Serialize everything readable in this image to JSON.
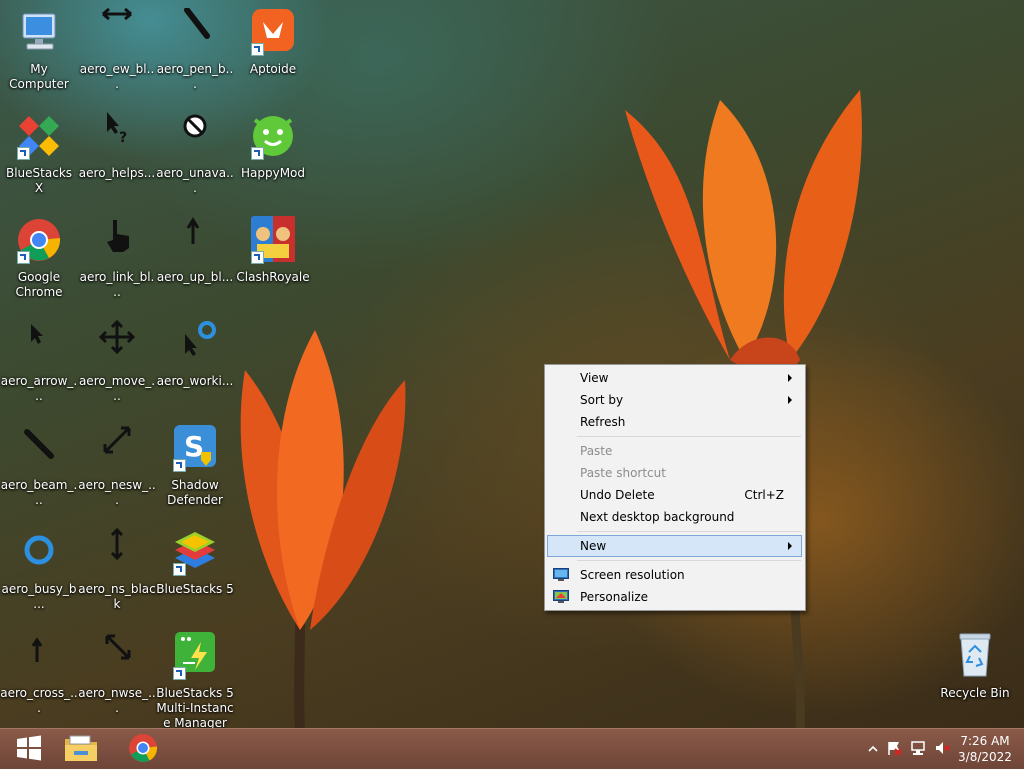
{
  "desktop_icons": [
    {
      "label": "My Computer",
      "icon": "computer-icon"
    },
    {
      "label": "aero_ew_bl...",
      "icon": "resize-horizontal-cursor-icon"
    },
    {
      "label": "aero_pen_b...",
      "icon": "pen-cursor-icon"
    },
    {
      "label": "Aptoide",
      "icon": "aptoide-icon"
    },
    {
      "label": "BlueStacks X",
      "icon": "bluestacks-x-icon"
    },
    {
      "label": "aero_helps...",
      "icon": "help-select-cursor-icon"
    },
    {
      "label": "aero_unava...",
      "icon": "unavailable-cursor-icon"
    },
    {
      "label": "HappyMod",
      "icon": "happymod-icon"
    },
    {
      "label": "Google Chrome",
      "icon": "chrome-icon"
    },
    {
      "label": "aero_link_bl...",
      "icon": "hand-cursor-icon"
    },
    {
      "label": "aero_up_bl...",
      "icon": "up-arrow-cursor-icon"
    },
    {
      "label": "ClashRoyale",
      "icon": "clash-royale-icon"
    },
    {
      "label": "aero_arrow_...",
      "icon": "arrow-cursor-icon"
    },
    {
      "label": "aero_move_...",
      "icon": "move-cursor-icon"
    },
    {
      "label": "aero_worki...",
      "icon": "working-cursor-icon"
    },
    {
      "label": "aero_beam_...",
      "icon": "text-beam-cursor-icon"
    },
    {
      "label": "aero_nesw_...",
      "icon": "resize-nesw-cursor-icon"
    },
    {
      "label": "Shadow Defender",
      "icon": "shadow-defender-icon"
    },
    {
      "label": "aero_busy_b...",
      "icon": "busy-cursor-icon"
    },
    {
      "label": "aero_ns_black",
      "icon": "resize-vertical-cursor-icon"
    },
    {
      "label": "BlueStacks 5",
      "icon": "bluestacks-5-icon"
    },
    {
      "label": "aero_cross_...",
      "icon": "crosshair-cursor-icon"
    },
    {
      "label": "aero_nwse_...",
      "icon": "resize-nwse-cursor-icon"
    },
    {
      "label": "BlueStacks 5 Multi-Instanc e Manager",
      "icon": "bluestacks-multi-instance-icon"
    },
    {
      "label": "Recycle Bin",
      "icon": "recycle-bin-icon"
    }
  ],
  "context_menu": {
    "view": "View",
    "sort_by": "Sort by",
    "refresh": "Refresh",
    "paste": "Paste",
    "paste_shortcut": "Paste shortcut",
    "undo_delete": "Undo Delete",
    "undo_delete_shortcut": "Ctrl+Z",
    "next_background": "Next desktop background",
    "new": "New",
    "screen_resolution": "Screen resolution",
    "personalize": "Personalize"
  },
  "taskbar": {
    "start": "windows-start-icon",
    "pinned": [
      "file-explorer-icon",
      "chrome-icon"
    ],
    "tray_icons": [
      "show-hidden-icons-chevron",
      "action-center-flag-icon",
      "network-icon",
      "volume-muted-icon"
    ],
    "time": "7:26 AM",
    "date": "3/8/2022"
  },
  "colors": {
    "taskbar": "#7a4e40",
    "menu_bg": "#f2f2f2",
    "menu_highlight": "#d5e6f8"
  }
}
